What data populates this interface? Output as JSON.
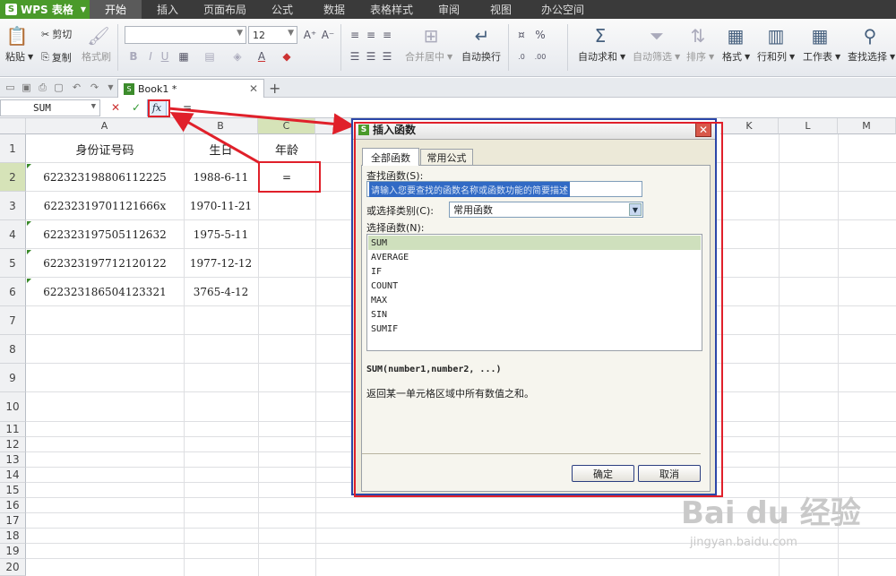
{
  "app": {
    "name": "WPS 表格",
    "logo": "S"
  },
  "menu": [
    "开始",
    "插入",
    "页面布局",
    "公式",
    "数据",
    "表格样式",
    "审阅",
    "视图",
    "办公空间"
  ],
  "ribbon": {
    "paste": "粘贴",
    "cut": "剪切",
    "copy": "复制",
    "format_painter": "格式刷",
    "font_size": "12",
    "merge_center": "合并居中",
    "wrap_text": "自动换行",
    "autosum": "自动求和",
    "autofilter": "自动筛选",
    "sort": "排序",
    "format": "格式",
    "rows_cols": "行和列",
    "sheet": "工作表",
    "find_select": "查找选择",
    "percent": "%"
  },
  "doc_tab": {
    "name": "Book1 *"
  },
  "formula_bar": {
    "name_box": "SUM",
    "fx": "fx",
    "content": "="
  },
  "columns": [
    "A",
    "B",
    "C",
    "K",
    "L",
    "M"
  ],
  "rows": [
    "1",
    "2",
    "3",
    "4",
    "5",
    "6",
    "7",
    "8",
    "9",
    "10",
    "11",
    "12",
    "13",
    "14",
    "15",
    "16",
    "17",
    "18",
    "19",
    "20"
  ],
  "cells": {
    "header": [
      "身份证号码",
      "生日",
      "年龄"
    ],
    "data": [
      [
        "622323198806112225",
        "1988-6-11",
        "="
      ],
      [
        "62232319701121666x",
        "1970-11-21",
        ""
      ],
      [
        "622323197505112632",
        "1975-5-11",
        ""
      ],
      [
        "622323197712120122",
        "1977-12-12",
        ""
      ],
      [
        "622323186504123321",
        "3765-4-12",
        ""
      ]
    ]
  },
  "dialog": {
    "title": "插入函数",
    "tabs": [
      "全部函数",
      "常用公式"
    ],
    "search_label": "查找函数(S):",
    "search_placeholder": "请输入您要查找的函数名称或函数功能的简要描述",
    "category_label": "或选择类别(C):",
    "category_value": "常用函数",
    "select_label": "选择函数(N):",
    "functions": [
      "SUM",
      "AVERAGE",
      "IF",
      "COUNT",
      "MAX",
      "SIN",
      "SUMIF"
    ],
    "signature": "SUM(number1,number2, ...)",
    "description": "返回某一单元格区域中所有数值之和。",
    "ok": "确定",
    "cancel": "取消"
  },
  "watermark": {
    "main": "Bai du 经验",
    "sub": "jingyan.baidu.com"
  },
  "colors": {
    "accent": "#4a9a2a",
    "annotation": "#e0202a",
    "dialog_border": "#2b46a8"
  }
}
